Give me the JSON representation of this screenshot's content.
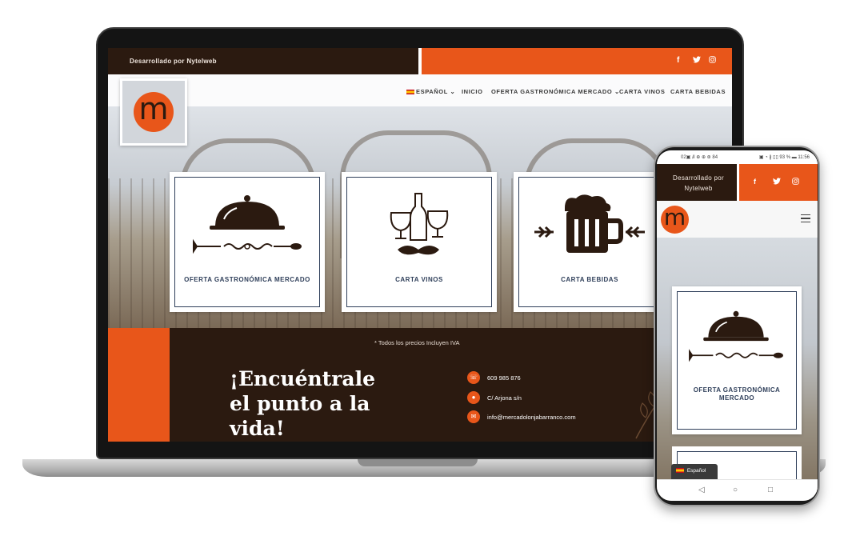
{
  "laptop": {
    "topbar": {
      "developer": "Desarrollado por Nytelweb",
      "social": [
        "f",
        "y",
        "◎"
      ]
    },
    "nav": {
      "logo_letter": "m",
      "items": [
        "ESPAÑOL ⌄",
        "INICIO",
        "OFERTA GASTRONÓMICA MERCADO ⌄",
        "CARTA VINOS",
        "CARTA BEBIDAS"
      ]
    },
    "cards": [
      {
        "label": "OFERTA GASTRONÓMICA MERCADO",
        "icon": "cloche-icon"
      },
      {
        "label": "CARTA VINOS",
        "icon": "wine-icon"
      },
      {
        "label": "CARTA BEBIDAS",
        "icon": "beer-icon"
      }
    ],
    "footer": {
      "iva_note": "* Todos los precios Incluyen IVA",
      "slogan": "¡Encuéntrale el punto a la vida!",
      "phone": "609 985 876",
      "address": "C/ Arjona s/n",
      "email": "info@mercadolonjabarranco.com"
    }
  },
  "phone": {
    "status_left": "02▣ ᵢll ⊕ ⊕ ⊛ 84",
    "status_right": "▣ ◔ ∦ ▯▯ 93 % ▬ 11:56",
    "developer": "Desarrollado por Nytelweb",
    "social": [
      "f",
      "y",
      "◎"
    ],
    "logo_letter": "m",
    "card_label": "OFERTA GASTRONÓMICA MERCADO",
    "language": "Español",
    "nav_buttons": [
      "◁",
      "○",
      "□"
    ]
  },
  "colors": {
    "brand_orange": "#e8561a",
    "dark_brown": "#2b1a10",
    "card_border": "#2f3f5a"
  }
}
